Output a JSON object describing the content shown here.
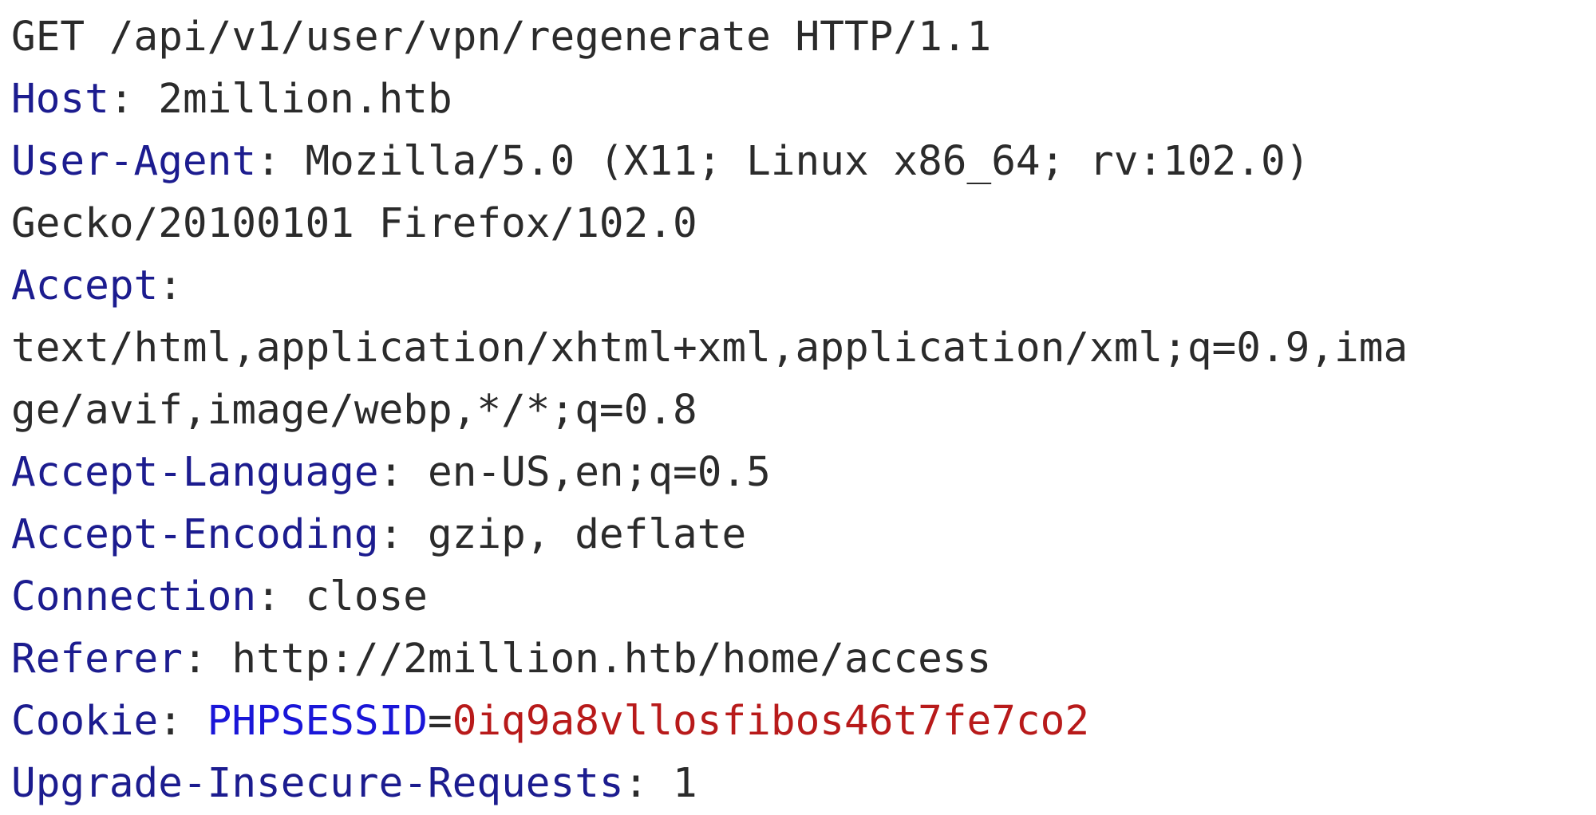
{
  "request": {
    "request_line": "GET /api/v1/user/vpn/regenerate HTTP/1.1",
    "host": {
      "name": "Host",
      "value": "2million.htb"
    },
    "user_agent": {
      "name": "User-Agent",
      "value_line1": "Mozilla/5.0 (X11; Linux x86_64; rv:102.0)",
      "value_line2": "Gecko/20100101 Firefox/102.0"
    },
    "accept": {
      "name": "Accept",
      "value_line1": "text/html,application/xhtml+xml,application/xml;q=0.9,ima",
      "value_line2": "ge/avif,image/webp,*/*;q=0.8"
    },
    "accept_language": {
      "name": "Accept-Language",
      "value": "en-US,en;q=0.5"
    },
    "accept_encoding": {
      "name": "Accept-Encoding",
      "value": "gzip, deflate"
    },
    "connection": {
      "name": "Connection",
      "value": "close"
    },
    "referer": {
      "name": "Referer",
      "value": "http://2million.htb/home/access"
    },
    "cookie": {
      "name": "Cookie",
      "cookie_name": "PHPSESSID",
      "separator": "=",
      "cookie_value": "0iq9a8vllosfibos46t7fe7co2"
    },
    "upgrade_insecure_requests": {
      "name": "Upgrade-Insecure-Requests",
      "value": "1"
    }
  },
  "colors": {
    "header_name": "#1c1c8f",
    "plain_text": "#2b2b2b",
    "cookie_name": "#1a16d8",
    "cookie_value": "#b81a1a",
    "background": "#ffffff"
  }
}
